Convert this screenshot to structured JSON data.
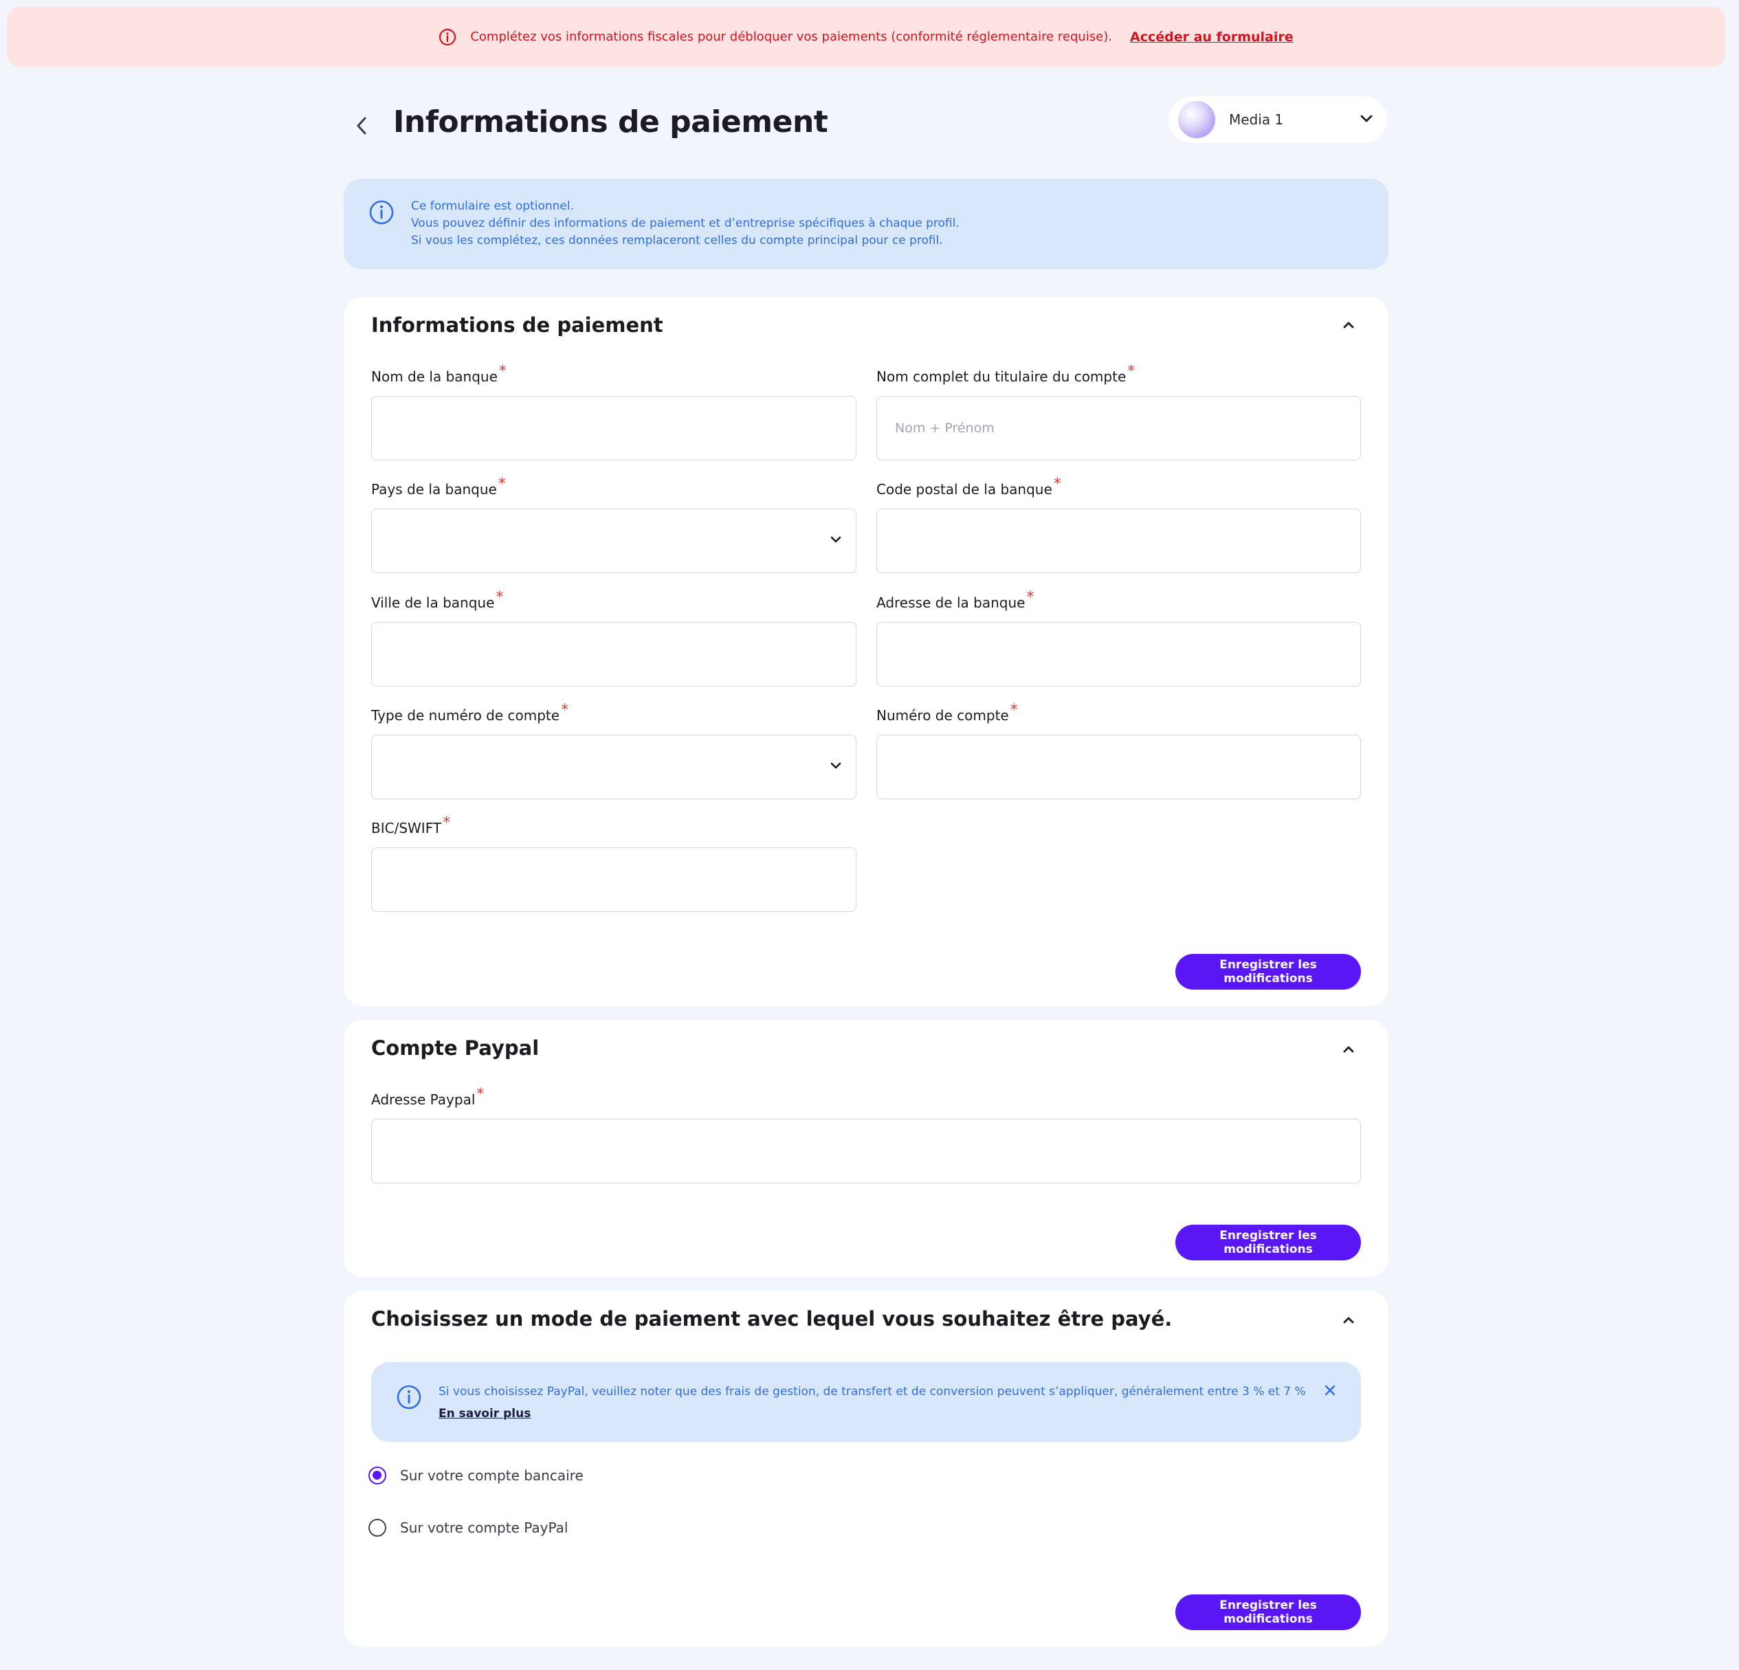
{
  "banner": {
    "message": "Complétez vos informations fiscales pour débloquer vos paiements (conformité réglementaire requise).",
    "link": "Accéder au formulaire",
    "icon": "alert-circle-icon",
    "color": "#d6121f"
  },
  "header": {
    "title": "Informations de paiement",
    "profile_name": "Media 1"
  },
  "info": {
    "line1": "Ce formulaire est optionnel.",
    "line2": "Vous pouvez définir des informations de paiement et d’entreprise spécifiques à chaque profil.",
    "line3": "Si vous les complétez, ces données remplaceront celles du compte principal pour ce profil."
  },
  "payment_card": {
    "title": "Informations de paiement",
    "bank_name_label": "Nom de la banque",
    "holder_label": "Nom complet du titulaire du compte",
    "holder_placeholder": "Nom + Prénom",
    "bank_country_label": "Pays de la banque",
    "bank_zip_label": "Code postal de la banque",
    "bank_city_label": "Ville de la banque",
    "bank_address_label": "Adresse de la banque",
    "account_type_label": "Type de numéro de compte",
    "account_number_label": "Numéro de compte",
    "bic_label": "BIC/SWIFT",
    "required_mark": "*",
    "save_label": "Enregistrer les modifications"
  },
  "paypal_card": {
    "title": "Compte Paypal",
    "address_label": "Adresse Paypal",
    "save_label": "Enregistrer les modifications"
  },
  "method_card": {
    "title": "Choisissez un mode de paiement avec lequel vous souhaitez être payé.",
    "notice_text": "Si vous choisissez PayPal, veuillez noter que des frais de gestion, de transfert et de conversion peuvent s’appliquer, généralement entre 3 % et 7 %",
    "notice_link": "En savoir plus",
    "option_bank": "Sur votre compte bancaire",
    "option_paypal": "Sur votre compte PayPal",
    "selected": "bank",
    "save_label": "Enregistrer les modifications"
  },
  "colors": {
    "accent": "#5b16f5",
    "info_bg": "#d9e7fb",
    "info_text": "#2f6fe0",
    "banner_bg": "#ffe3e3",
    "page_bg": "#f3f5fd"
  }
}
